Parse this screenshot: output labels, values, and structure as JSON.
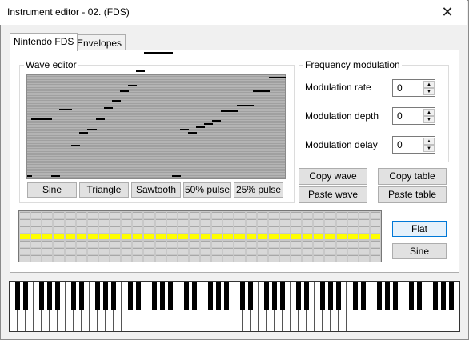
{
  "window": {
    "title": "Instrument editor - 02.  (FDS)",
    "close_glyph": "✕"
  },
  "tabs": [
    {
      "label": "Nintendo FDS",
      "active": true
    },
    {
      "label": "Envelopes",
      "active": false
    }
  ],
  "wave_editor": {
    "group_label": "Wave editor",
    "samples_0_63": [
      0,
      37,
      37,
      37,
      37,
      37,
      0,
      0,
      43,
      43,
      43,
      20,
      20,
      28,
      28,
      30,
      30,
      37,
      37,
      44,
      44,
      49,
      49,
      55,
      55,
      59,
      59,
      68,
      68,
      80,
      80,
      80,
      80,
      80,
      80,
      80,
      0,
      0,
      30,
      30,
      28,
      28,
      32,
      32,
      34,
      34,
      36,
      36,
      42,
      42,
      42,
      42,
      46,
      46,
      46,
      46,
      55,
      55,
      55,
      55,
      64,
      64,
      64,
      64
    ],
    "buttons": [
      "Sine",
      "Triangle",
      "Sawtooth",
      "50% pulse",
      "25% pulse"
    ]
  },
  "frequency_modulation": {
    "group_label": "Frequency modulation",
    "fields": [
      {
        "label": "Modulation rate",
        "value": "0"
      },
      {
        "label": "Modulation depth",
        "value": "0"
      },
      {
        "label": "Modulation delay",
        "value": "0"
      }
    ]
  },
  "table_buttons": {
    "copy_wave": "Copy wave",
    "copy_table": "Copy table",
    "paste_wave": "Paste wave",
    "paste_table": "Paste table"
  },
  "mod_table": {
    "steps": 32,
    "level_row": 3,
    "rows": 7,
    "highlight_color": "#ffff00"
  },
  "mod_buttons": {
    "flat": "Flat",
    "sine": "Sine"
  },
  "piano": {
    "white_key_count": 56
  }
}
